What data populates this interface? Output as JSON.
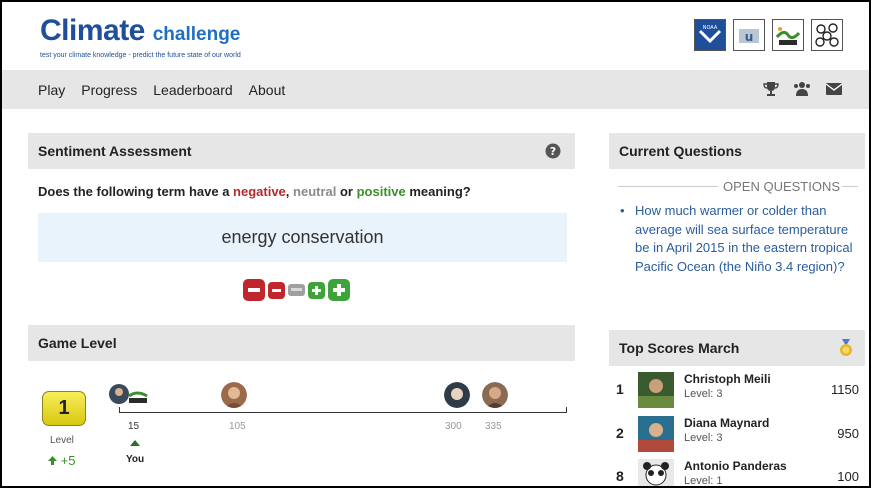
{
  "header": {
    "logo_title": "Climate",
    "logo_title_small": "challenge",
    "logo_tagline": "test your climate knowledge - predict the future state of our world",
    "partners": [
      "NOAA Climate",
      "university logo",
      "myLyzard logo",
      "network logo"
    ]
  },
  "nav": {
    "links": [
      "Play",
      "Progress",
      "Leaderboard",
      "About"
    ],
    "icons": [
      "trophy-icon",
      "users-icon",
      "envelope-icon"
    ]
  },
  "sentiment": {
    "title": "Sentiment Assessment",
    "help_icon": "question-circle-icon",
    "question_prefix": "Does the following term have a ",
    "negative": "negative",
    "sep1": ", ",
    "neutral": "neutral",
    "sep2": " or ",
    "positive": "positive",
    "question_suffix": " meaning?",
    "term": "energy conservation",
    "rating_buttons": [
      "very-negative",
      "negative",
      "neutral",
      "positive",
      "very-positive"
    ],
    "colors": {
      "negative": "#b52a2a",
      "neutral": "#8a8a8a",
      "positive": "#3b8f2a"
    }
  },
  "game_level": {
    "title": "Game Level",
    "level": "1",
    "level_label": "Level",
    "level_change": "+5",
    "you_score": "15",
    "you_label": "You",
    "markers": [
      "105",
      "300",
      "335"
    ]
  },
  "current_questions": {
    "title": "Current Questions",
    "open_label": "OPEN QUESTIONS",
    "questions": [
      "How much warmer or colder than average will sea surface temperature be in April 2015 in the eastern tropical Pacific Ocean (the Niño 3.4 region)?"
    ]
  },
  "top_scores": {
    "title": "Top Scores March",
    "rows": [
      {
        "rank": "1",
        "name": "Christoph Meili",
        "level": "Level: 3",
        "score": "1150"
      },
      {
        "rank": "2",
        "name": "Diana Maynard",
        "level": "Level: 3",
        "score": "950"
      },
      {
        "rank": "8",
        "name": "Antonio Panderas",
        "level": "Level: 1",
        "score": "100"
      }
    ]
  }
}
